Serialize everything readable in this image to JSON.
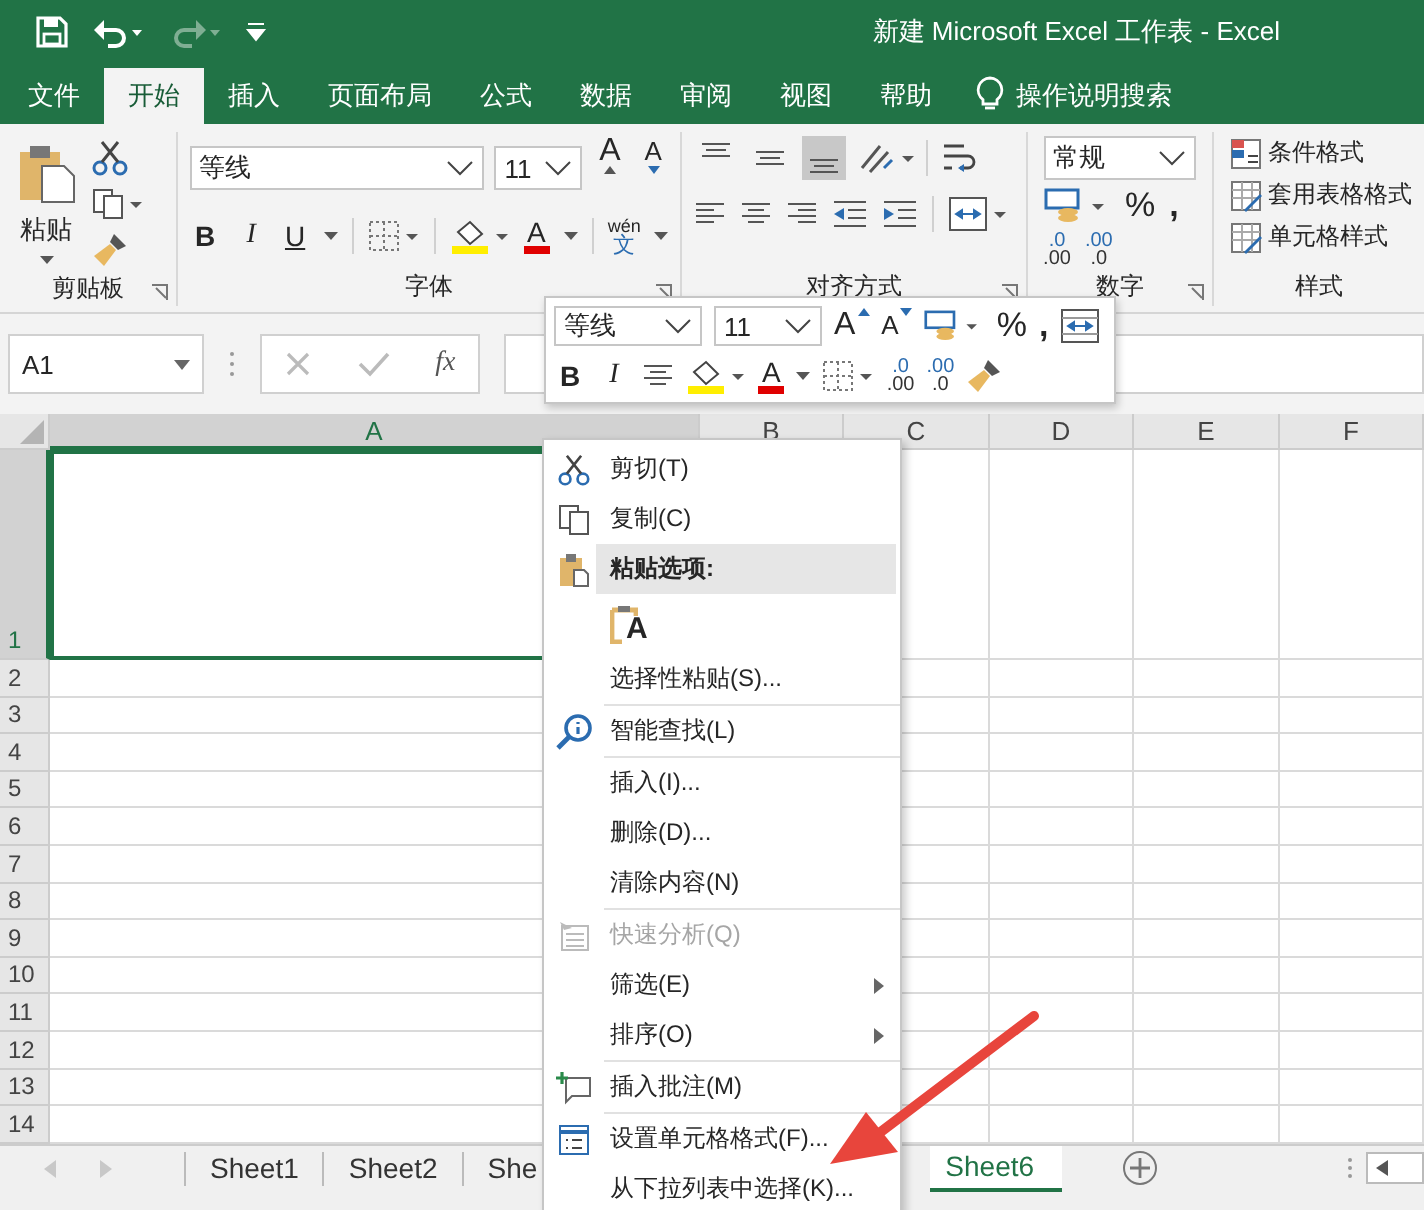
{
  "window": {
    "title": "新建 Microsoft Excel 工作表  -  Excel"
  },
  "ribbon_tabs": [
    {
      "label": "文件",
      "selected": false
    },
    {
      "label": "开始",
      "selected": true
    },
    {
      "label": "插入",
      "selected": false
    },
    {
      "label": "页面布局",
      "selected": false
    },
    {
      "label": "公式",
      "selected": false
    },
    {
      "label": "数据",
      "selected": false
    },
    {
      "label": "审阅",
      "selected": false
    },
    {
      "label": "视图",
      "selected": false
    },
    {
      "label": "帮助",
      "selected": false
    }
  ],
  "tell_me": {
    "label": "操作说明搜索"
  },
  "clipboard": {
    "paste_label": "粘贴",
    "group_label": "剪贴板"
  },
  "font_group": {
    "font": "等线",
    "size": "11",
    "grow": "A",
    "shrink": "A",
    "bold": "B",
    "italic": "I",
    "underline": "U",
    "font_color": "A",
    "phonetic_top": "wén",
    "phonetic_bottom": "文",
    "group_label": "字体"
  },
  "alignment": {
    "vertical": [
      {
        "kind": "top",
        "selected": false
      },
      {
        "kind": "middle",
        "selected": false
      },
      {
        "kind": "bottom",
        "selected": true
      }
    ],
    "group_label": "对齐方式"
  },
  "number": {
    "format": "常规",
    "percent": "%",
    "comma": ",",
    "decimals": [
      {
        "top": ".0",
        "bottom": ".00"
      },
      {
        "top": ".00",
        "bottom": ".0"
      }
    ],
    "group_label": "数字"
  },
  "styles": {
    "items": [
      {
        "kind": "conditional",
        "label": "条件格式"
      },
      {
        "kind": "table",
        "label": "套用表格格式"
      },
      {
        "kind": "cell",
        "label": "单元格样式"
      }
    ],
    "group_label": "样式"
  },
  "formula_bar": {
    "name_box": "A1",
    "function_label": "fx"
  },
  "mini_toolbar": {
    "font": "等线",
    "size": "11",
    "grow": "A",
    "shrink": "A",
    "percent": "%",
    "comma": ",",
    "bold": "B",
    "italic": "I",
    "font_color": "A",
    "decimals": [
      {
        "top": ".0",
        "bottom": ".00"
      },
      {
        "top": ".00",
        "bottom": ".0"
      }
    ]
  },
  "columns": [
    {
      "label": "A",
      "selected": true
    },
    {
      "label": "B",
      "selected": false
    },
    {
      "label": "C",
      "selected": false
    },
    {
      "label": "D",
      "selected": false
    },
    {
      "label": "E",
      "selected": false
    },
    {
      "label": "F",
      "selected": false
    }
  ],
  "rows": [
    {
      "label": "1",
      "selected": true
    },
    {
      "label": "2",
      "selected": false
    },
    {
      "label": "3",
      "selected": false
    },
    {
      "label": "4",
      "selected": false
    },
    {
      "label": "5",
      "selected": false
    },
    {
      "label": "6",
      "selected": false
    },
    {
      "label": "7",
      "selected": false
    },
    {
      "label": "8",
      "selected": false
    },
    {
      "label": "9",
      "selected": false
    },
    {
      "label": "10",
      "selected": false
    },
    {
      "label": "11",
      "selected": false
    },
    {
      "label": "12",
      "selected": false
    },
    {
      "label": "13",
      "selected": false
    },
    {
      "label": "14",
      "selected": false
    }
  ],
  "context_menu": {
    "items": [
      {
        "kind": "cut",
        "label": "剪切(T)",
        "disabled": false,
        "submenu": false,
        "divider_after": false
      },
      {
        "kind": "copy",
        "label": "复制(C)",
        "disabled": false,
        "submenu": false,
        "divider_after": false
      },
      {
        "kind": "paste_header",
        "label": "粘贴选项:",
        "disabled": false,
        "submenu": false,
        "divider_after": false
      },
      {
        "kind": "paste_option",
        "label": "A",
        "disabled": false,
        "submenu": false,
        "divider_after": false
      },
      {
        "kind": "plain",
        "label": "选择性粘贴(S)...",
        "disabled": false,
        "submenu": false,
        "divider_after": true
      },
      {
        "kind": "lookup",
        "label": "智能查找(L)",
        "disabled": false,
        "submenu": false,
        "divider_after": true
      },
      {
        "kind": "plain",
        "label": "插入(I)...",
        "disabled": false,
        "submenu": false,
        "divider_after": false
      },
      {
        "kind": "plain",
        "label": "删除(D)...",
        "disabled": false,
        "submenu": false,
        "divider_after": false
      },
      {
        "kind": "plain",
        "label": "清除内容(N)",
        "disabled": false,
        "submenu": false,
        "divider_after": true
      },
      {
        "kind": "quick_analysis",
        "label": "快速分析(Q)",
        "disabled": true,
        "submenu": false,
        "divider_after": false
      },
      {
        "kind": "plain",
        "label": "筛选(E)",
        "disabled": false,
        "submenu": true,
        "divider_after": false
      },
      {
        "kind": "plain",
        "label": "排序(O)",
        "disabled": false,
        "submenu": true,
        "divider_after": true
      },
      {
        "kind": "comment",
        "label": "插入批注(M)",
        "disabled": false,
        "submenu": false,
        "divider_after": true
      },
      {
        "kind": "format_cells",
        "label": "设置单元格格式(F)...",
        "disabled": false,
        "submenu": false,
        "divider_after": false
      },
      {
        "kind": "plain",
        "label": "从下拉列表中选择(K)...",
        "disabled": false,
        "submenu": false,
        "divider_after": false
      }
    ]
  },
  "sheet_tabs": [
    {
      "label": "Sheet1",
      "selected": false
    },
    {
      "label": "Sheet2",
      "selected": false
    },
    {
      "label": "She",
      "selected": false
    },
    {
      "label": "Sheet6",
      "selected": true
    }
  ]
}
